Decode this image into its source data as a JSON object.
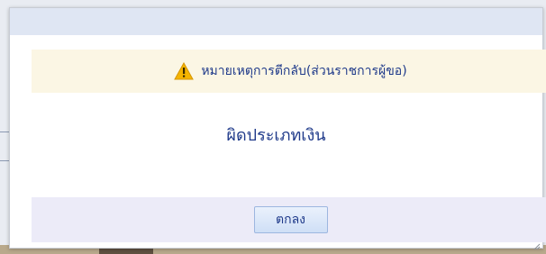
{
  "dialog": {
    "warning_text": "หมายเหตุการตีกลับ(ส่วนราชการผู้ขอ)",
    "message": "ผิดประเภทเงิน",
    "ok_label": "ตกลง",
    "warning_icon": "warning-triangle-icon",
    "resize_icon": "resize-grip-icon"
  },
  "colors": {
    "text_blue": "#1f3a8a",
    "warning_bg": "#fbf6e4",
    "footer_bg": "#ecebf8",
    "titlebar_bg": "#dfe6f3"
  }
}
